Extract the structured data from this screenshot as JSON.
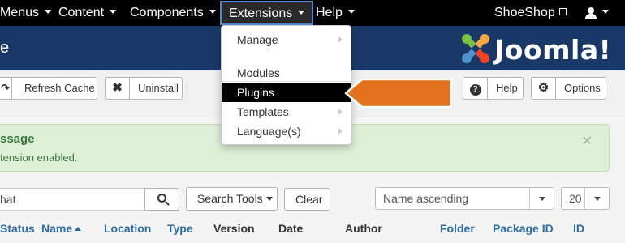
{
  "topnav": {
    "menus_label": "Menus",
    "content_label": "Content",
    "components_label": "Components",
    "extensions_label": "Extensions",
    "help_label": "Help",
    "site_label": "ShoeShop"
  },
  "header": {
    "page_title": "e",
    "logo_text": "Joomla!"
  },
  "toolbar": {
    "refresh_cache_label": "Refresh Cache",
    "uninstall_label": "Uninstall",
    "help_label": "Help",
    "options_label": "Options"
  },
  "message": {
    "title": "ssage",
    "text": "tension enabled."
  },
  "filters": {
    "search_value": "hat",
    "search_tools_label": "Search Tools",
    "clear_label": "Clear",
    "sort_value": "Name ascending",
    "limit_value": "20"
  },
  "columns": {
    "status": "Status",
    "name": "Name",
    "location": "Location",
    "type": "Type",
    "version": "Version",
    "date": "Date",
    "author": "Author",
    "folder": "Folder",
    "package_id": "Package ID",
    "id": "ID"
  },
  "extensions_menu": {
    "items": [
      {
        "label": "Manage"
      },
      {
        "label": "Modules"
      },
      {
        "label": "Plugins"
      },
      {
        "label": "Templates"
      },
      {
        "label": "Language(s)"
      }
    ]
  },
  "colors": {
    "header_bg": "#1a3867",
    "callout": "#e2711d",
    "message_bg": "#dff0d8"
  }
}
